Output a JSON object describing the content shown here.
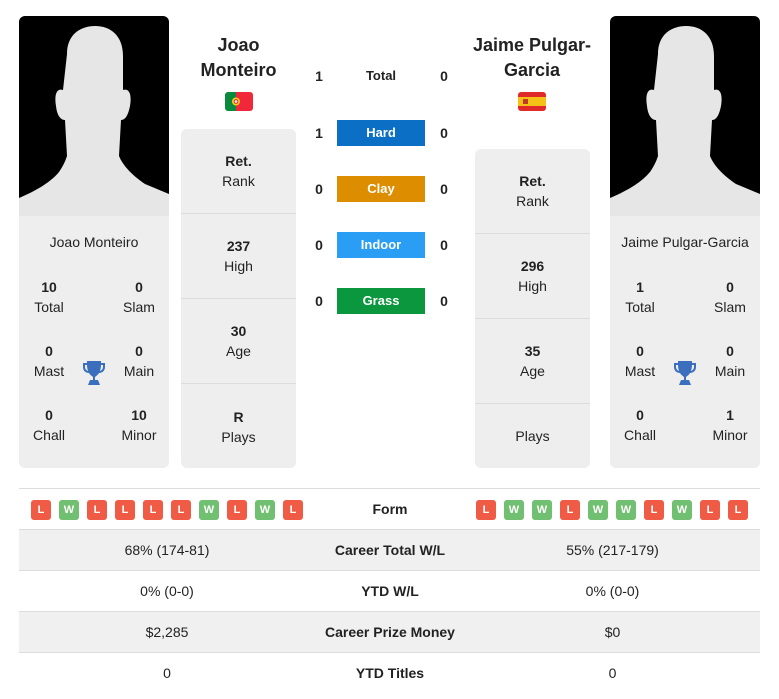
{
  "colors": {
    "hard": "#0b6fc6",
    "clay": "#dc8e00",
    "indoor": "#2a9df4",
    "grass": "#0a973d",
    "loss": "#ef5b45",
    "win": "#71bf70",
    "trophy": "#3b6fbe"
  },
  "player1": {
    "name_line1": "Joao",
    "name_line2": "Monteiro",
    "full_name": "Joao Monteiro",
    "flag": "portugal-flag",
    "titles": {
      "total": "10",
      "total_label": "Total",
      "slam": "0",
      "slam_label": "Slam",
      "mast": "0",
      "mast_label": "Mast",
      "main": "0",
      "main_label": "Main",
      "chall": "0",
      "chall_label": "Chall",
      "minor": "10",
      "minor_label": "Minor"
    },
    "stats": {
      "rank_value": "Ret.",
      "rank_label": "Rank",
      "high_value": "237",
      "high_label": "High",
      "age_value": "30",
      "age_label": "Age",
      "plays_value": "R",
      "plays_label": "Plays"
    },
    "form": [
      "L",
      "W",
      "L",
      "L",
      "L",
      "L",
      "W",
      "L",
      "W",
      "L"
    ]
  },
  "player2": {
    "name_line1": "Jaime Pulgar-",
    "name_line2": "Garcia",
    "full_name": "Jaime Pulgar-Garcia",
    "flag": "spain-flag",
    "titles": {
      "total": "1",
      "total_label": "Total",
      "slam": "0",
      "slam_label": "Slam",
      "mast": "0",
      "mast_label": "Mast",
      "main": "0",
      "main_label": "Main",
      "chall": "0",
      "chall_label": "Chall",
      "minor": "1",
      "minor_label": "Minor"
    },
    "stats": {
      "rank_value": "Ret.",
      "rank_label": "Rank",
      "high_value": "296",
      "high_label": "High",
      "age_value": "35",
      "age_label": "Age",
      "plays_value": "",
      "plays_label": "Plays"
    },
    "form": [
      "L",
      "W",
      "W",
      "L",
      "W",
      "W",
      "L",
      "W",
      "L",
      "L"
    ]
  },
  "h2h": [
    {
      "label": "Total",
      "p1": "1",
      "p2": "0"
    },
    {
      "label": "Hard",
      "p1": "1",
      "p2": "0"
    },
    {
      "label": "Clay",
      "p1": "0",
      "p2": "0"
    },
    {
      "label": "Indoor",
      "p1": "0",
      "p2": "0"
    },
    {
      "label": "Grass",
      "p1": "0",
      "p2": "0"
    }
  ],
  "table": {
    "form_label": "Form",
    "rows": [
      {
        "label": "Career Total W/L",
        "p1": "68% (174-81)",
        "p2": "55% (217-179)"
      },
      {
        "label": "YTD W/L",
        "p1": "0% (0-0)",
        "p2": "0% (0-0)"
      },
      {
        "label": "Career Prize Money",
        "p1": "$2,285",
        "p2": "$0"
      },
      {
        "label": "YTD Titles",
        "p1": "0",
        "p2": "0"
      }
    ]
  }
}
